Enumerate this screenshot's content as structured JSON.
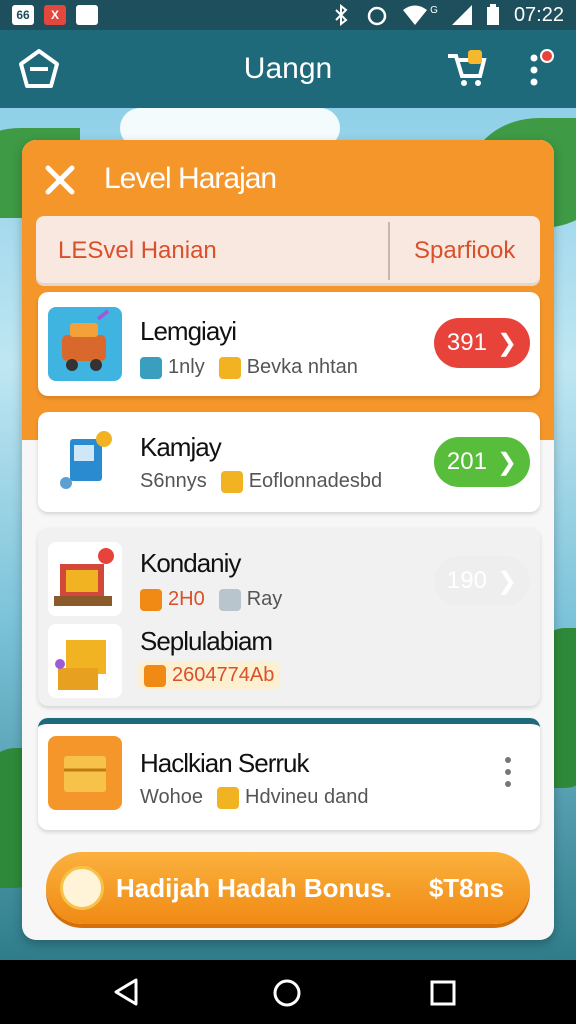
{
  "status_bar": {
    "left_icons": [
      "66",
      "X"
    ],
    "time": "07:22",
    "signal_label": "G"
  },
  "app_bar": {
    "title": "Uangn",
    "icons": [
      "logo-icon",
      "cart-icon",
      "more-icon"
    ]
  },
  "dialog": {
    "title": "Level Harajan",
    "tabs": [
      {
        "label": "LESvel Hanian"
      },
      {
        "label": "Sparfiook"
      }
    ],
    "items": [
      {
        "name": "Lemgiayi",
        "meta1": "1nly",
        "meta2": "Bevka nhtan",
        "button": "391",
        "button_color": "#e8433a"
      },
      {
        "name": "Kamjay",
        "meta1": "S6nnys",
        "meta2": "Eoflonnadesbd",
        "button": "201",
        "button_color": "#58bd3b"
      },
      {
        "name": "Kondaniy",
        "meta1": "2H0",
        "meta2": "Ray",
        "button": "190",
        "button_color": "#eeeeee"
      },
      {
        "name": "Seplulabiam",
        "meta1": "2604774Ab"
      },
      {
        "name": "Haclkian Serruk",
        "meta1": "Wohoe",
        "meta2": "Hdvineu dand"
      }
    ],
    "bonus": {
      "label": "Hadijah Hadah Bonus.",
      "price": "$T8ns"
    }
  },
  "colors": {
    "orange": "#f5962a",
    "teal": "#1f6a7a",
    "red": "#e8433a",
    "green": "#58bd3b"
  }
}
